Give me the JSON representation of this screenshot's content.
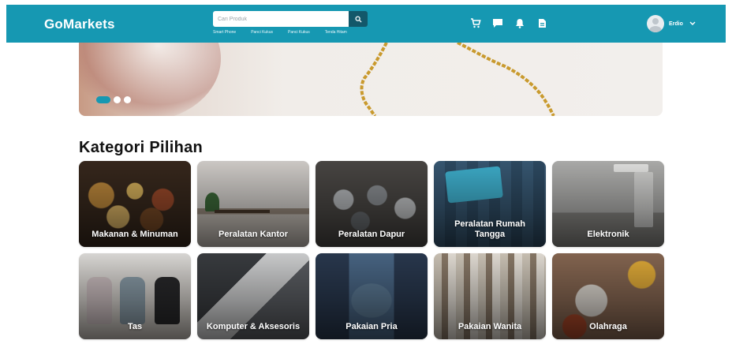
{
  "header": {
    "logo": "GoMarkets",
    "search": {
      "placeholder": "Cari Produk",
      "value": ""
    },
    "quick_links": [
      "Smart Phone",
      "Panci Kukus",
      "Panci Kukus",
      "Tenda Hitam"
    ],
    "icons": [
      "cart-icon",
      "chat-icon",
      "bell-icon",
      "receipt-icon"
    ],
    "user": {
      "name": "Erdio"
    }
  },
  "banner": {
    "slides_total": 3,
    "active_slide": 1
  },
  "section_title": "Kategori Pilihan",
  "categories": [
    {
      "label": "Makanan & Minuman",
      "image": "food"
    },
    {
      "label": "Peralatan Kantor",
      "image": "office"
    },
    {
      "label": "Peralatan Dapur",
      "image": "kitchen"
    },
    {
      "label": "Peralatan Rumah Tangga",
      "image": "household"
    },
    {
      "label": "Elektronik",
      "image": "electronics"
    },
    {
      "label": "Tas",
      "image": "bags"
    },
    {
      "label": "Komputer & Aksesoris",
      "image": "computer"
    },
    {
      "label": "Pakaian Pria",
      "image": "men-clothing"
    },
    {
      "label": "Pakaian Wanita",
      "image": "women-clothing"
    },
    {
      "label": "Olahraga",
      "image": "sports"
    }
  ],
  "colors": {
    "brand": "#1698b2",
    "search_button": "#13586a"
  }
}
